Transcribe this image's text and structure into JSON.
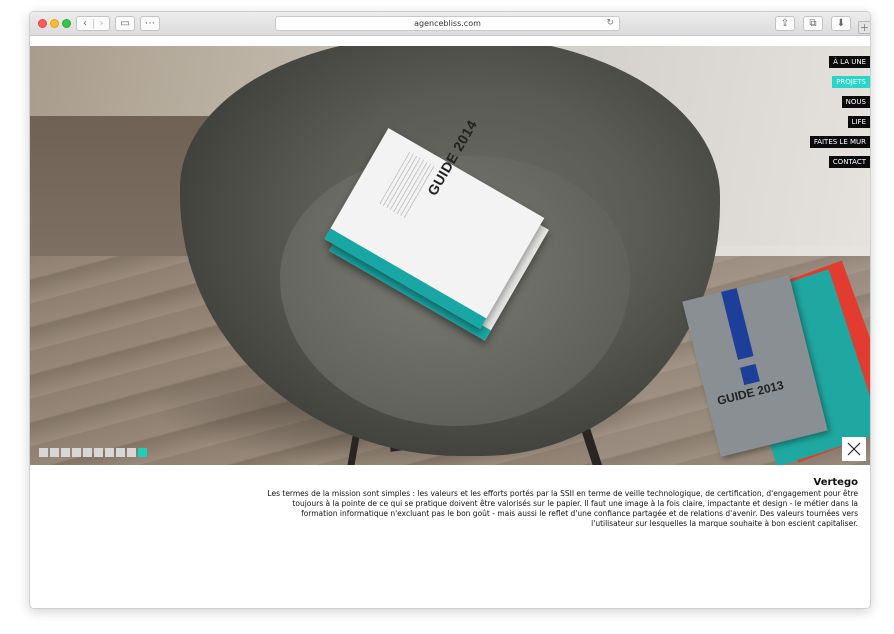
{
  "browser": {
    "url": "agencebliss.com",
    "back_glyph": "‹",
    "forward_glyph": "›",
    "sidebar_glyph": "▭",
    "grid_glyph": "⋯",
    "reload_glyph": "↻",
    "share_glyph": "⇪",
    "tabs_glyph": "⧉",
    "download_glyph": "⬇",
    "newtab_glyph": "+"
  },
  "hero": {
    "book_main_title": "GUIDE 2014",
    "book_grey_title": "GUIDE 2013"
  },
  "menu": {
    "items": [
      {
        "label": "À LA UNE",
        "active": false
      },
      {
        "label": "PROJETS",
        "active": true
      },
      {
        "label": "NOUS",
        "active": false
      },
      {
        "label": "LIFE",
        "active": false
      },
      {
        "label": "FAITES LE MUR",
        "active": false
      },
      {
        "label": "CONTACT",
        "active": false
      }
    ]
  },
  "slider": {
    "total": 10,
    "active_index": 9
  },
  "caption": {
    "title": "Vertego",
    "body": "Les termes de la mission sont simples : les valeurs et les efforts portés par la SSII en terme de veille technologique, de certification, d'engagement pour être toujours à la pointe de ce qui se pratique doivent être valorisés sur le papier. Il faut une image à la fois claire, impactante et design - le métier dans la formation informatique n'excluant pas le bon goût - mais aussi le reflet d'une confiance partagée et de relations d'avenir. Des valeurs tournées vers l'utilisateur sur lesquelles la marque souhaite à bon escient capitaliser."
  },
  "colors": {
    "accent": "#28d5c9",
    "menu_bg": "#0b0b0b"
  }
}
